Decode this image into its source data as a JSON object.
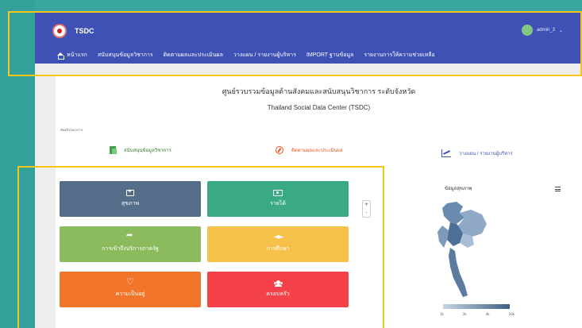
{
  "app": {
    "brand": "TSDC",
    "user": "admin_3",
    "caret": "⌄"
  },
  "nav": [
    {
      "label": "หน้าแรก"
    },
    {
      "label": "สนับสนุนข้อมูลวิชาการ"
    },
    {
      "label": "ติดตามผลและประเมินผล"
    },
    {
      "label": "วางแผน / รายงานผู้บริหาร"
    },
    {
      "label": "IMPORT ฐานข้อมูล"
    },
    {
      "label": "รายงานการให้ความช่วยเหลือ"
    }
  ],
  "header": {
    "title": "ศูนย์รวบรวมข้อมูลด้านสังคมและสนับสนุนวิชาการ ระดับจังหวัด",
    "subtitle": "Thailand Social Data Center (TSDC)",
    "section_label": "พันธกิจโครงการ"
  },
  "quick_links": [
    {
      "label": "สนับสนุนข้อมูลวิชาการ",
      "color": "#2e7d32",
      "icon": "document-icon"
    },
    {
      "label": "ติดตามผลและประเมินผล",
      "color": "#f4511e",
      "icon": "compass-icon"
    },
    {
      "label": "วางแผน / รายงานผู้บริหาร",
      "color": "#3f51b5",
      "icon": "line-chart-icon"
    }
  ],
  "tiles": [
    {
      "label": "สุขภาพ",
      "color": "#546e8a",
      "icon": "medical-icon"
    },
    {
      "label": "รายได้",
      "color": "#3aa985",
      "icon": "money-icon"
    },
    {
      "label": "การเข้าถึงบริการภาครัฐ",
      "color": "#8bbb5c",
      "icon": "share-icon"
    },
    {
      "label": "การศึกษา",
      "color": "#f6c14b",
      "icon": "graduation-cap-icon"
    },
    {
      "label": "ความเป็นอยู่",
      "color": "#f27629",
      "icon": "heart-icon"
    },
    {
      "label": "ครอบครัว",
      "color": "#f5424a",
      "icon": "users-icon"
    }
  ],
  "map": {
    "title": "ข้อมูลสุขภาพ",
    "zoom_in": "+",
    "zoom_out": "-",
    "legend": [
      "1k",
      "2k",
      "4k",
      "10k"
    ]
  },
  "colors": {
    "topbar": "#3f51b5",
    "background": "#3aa6a0",
    "highlight": "#f5c518"
  }
}
